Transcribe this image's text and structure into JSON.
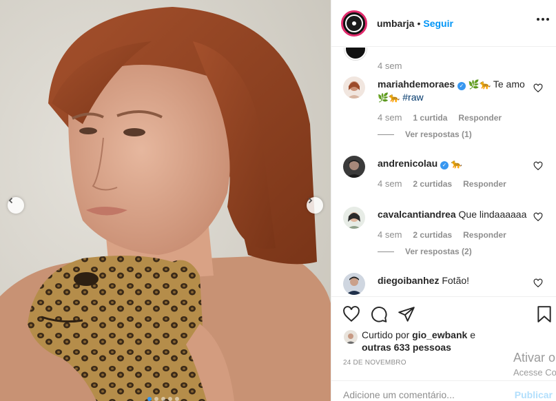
{
  "post": {
    "username": "umbarja",
    "dot": "•",
    "follow_label": "Seguir"
  },
  "comments_top_time": "4 sem",
  "comments": [
    {
      "username": "mariahdemoraes",
      "verified": true,
      "emoji1": "🌿",
      "emoji2": "🐆",
      "text": "Te amo",
      "emoji3": "🌿",
      "emoji4": "🐆",
      "hashtag": "#raw",
      "time": "4 sem",
      "likes": "1 curtida",
      "reply_label": "Responder",
      "view_replies": "Ver respostas (1)"
    },
    {
      "username": "andrenicolau",
      "verified": true,
      "emoji1": "🐆",
      "time": "4 sem",
      "likes": "2 curtidas",
      "reply_label": "Responder"
    },
    {
      "username": "cavalcantiandrea",
      "text": "Que lindaaaaaa",
      "time": "4 sem",
      "likes": "2 curtidas",
      "reply_label": "Responder",
      "view_replies": "Ver respostas (2)"
    },
    {
      "username": "diegoibanhez",
      "text": "Fotão!"
    }
  ],
  "liked_by": {
    "prefix": "Curtido por",
    "user": "gio_ewbank",
    "conj": "e",
    "others": "outras 633 pessoas"
  },
  "date": "24 DE NOVEMBRO",
  "add_comment": {
    "placeholder": "Adicione um comentário...",
    "publish_label": "Publicar"
  },
  "watermark": {
    "title": "Ativar o",
    "subtitle": "Acesse Co"
  },
  "icons": [
    "chevron-left-icon",
    "chevron-right-icon",
    "more-icon",
    "heart-icon",
    "comment-icon",
    "share-icon",
    "bookmark-icon"
  ],
  "colors": {
    "accent": "#0095f6",
    "verified": "#3897f0",
    "muted": "#8e8e8e",
    "publish_disabled": "#b2dffc"
  },
  "carousel": {
    "slide_count": 5,
    "active_slide": 1
  }
}
